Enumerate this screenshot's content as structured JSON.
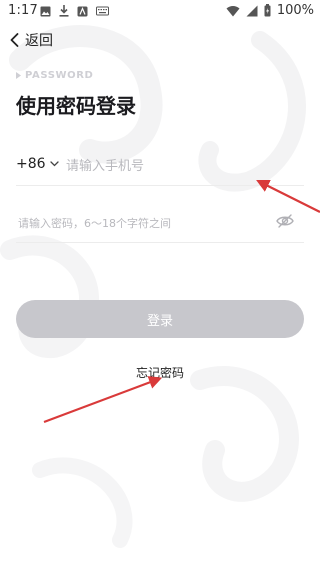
{
  "status_bar": {
    "time": "1:17",
    "battery": "100%"
  },
  "header": {
    "back_label": "返回"
  },
  "login": {
    "section_label": "PASSWORD",
    "title": "使用密码登录",
    "country_code": "+86",
    "phone_placeholder": "请输入手机号",
    "password_placeholder": "请输入密码，6～18个字符之间",
    "login_button": "登录",
    "forgot_password": "忘记密码"
  },
  "colors": {
    "accent_annotation": "#d93a3a",
    "button_disabled": "#c7c7cc"
  }
}
